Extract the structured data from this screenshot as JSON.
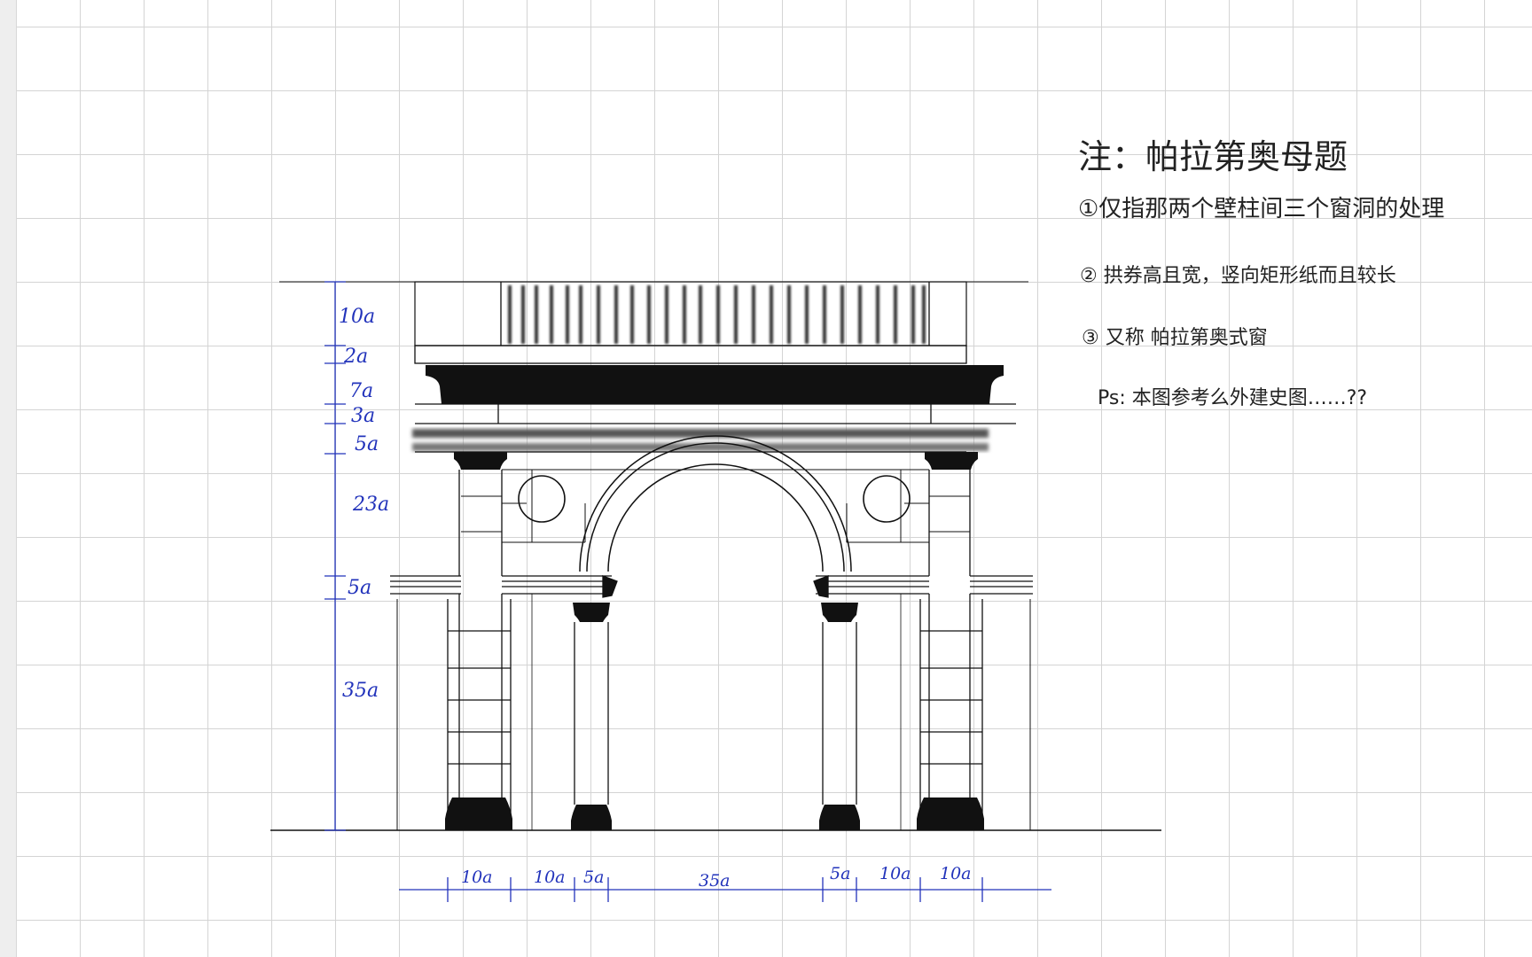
{
  "notes": {
    "title": "注：帕拉第奥母题",
    "item1": "①仅指那两个壁柱间三个窗洞的处理",
    "item2": "② 拱券高且宽，竖向矩形纸而且较长",
    "item3": "③ 又称 帕拉第奥式窗",
    "ps": "Ps: 本图参考么外建史图……??"
  },
  "dimensions": {
    "vertical": [
      "10a",
      "2a",
      "7a",
      "3a",
      "5a",
      "23a",
      "5a",
      "35a"
    ],
    "horizontal": [
      "10a",
      "10a",
      "5a",
      "35a",
      "5a",
      "10a",
      "10a"
    ]
  },
  "colors": {
    "ink": "#111111",
    "dimension": "#2233bb",
    "grid": "#d4d4d4"
  }
}
